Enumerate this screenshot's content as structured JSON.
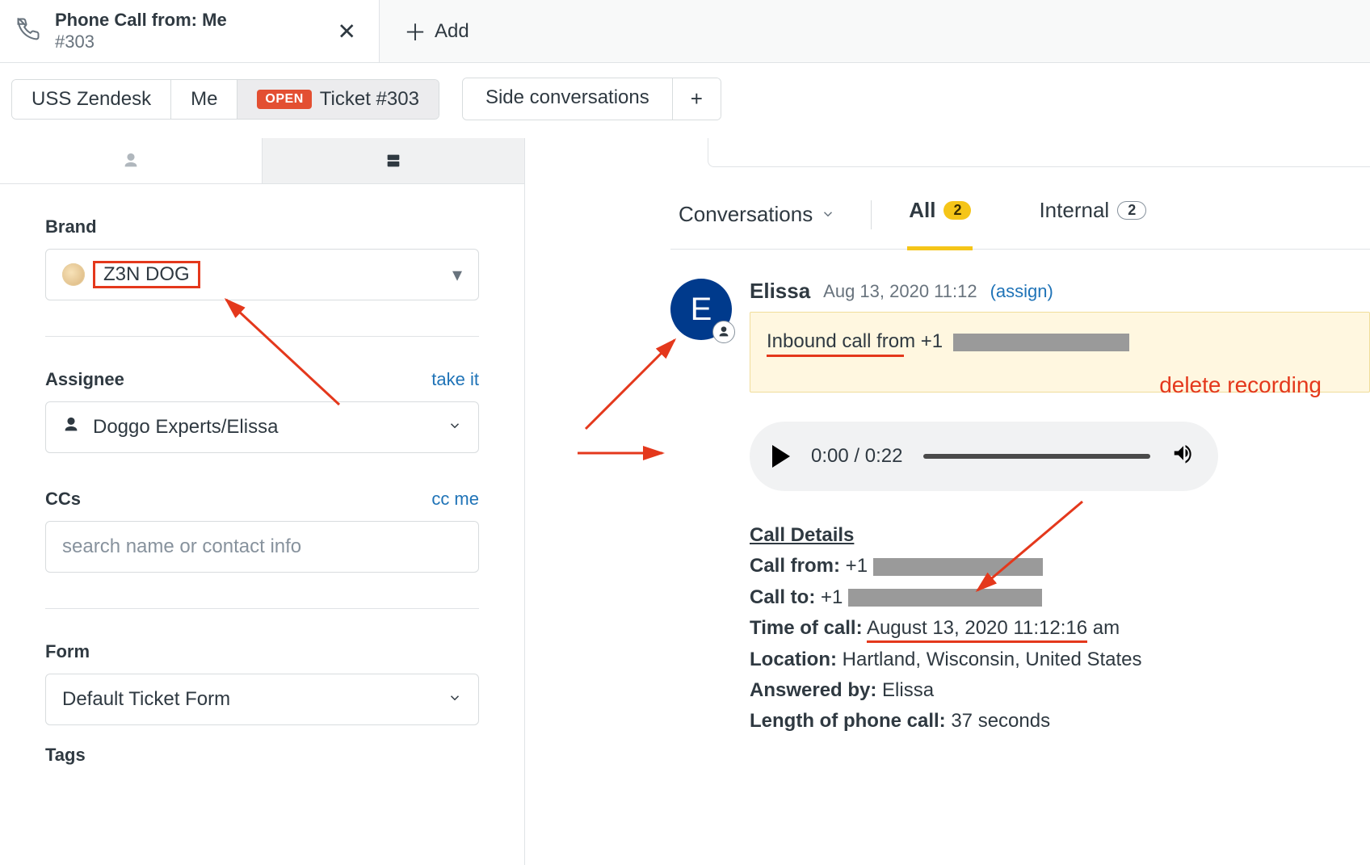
{
  "tab": {
    "title": "Phone Call from: Me",
    "sub": "#303",
    "add_label": "Add"
  },
  "breadcrumb": {
    "org": "USS Zendesk",
    "requester": "Me",
    "status": "OPEN",
    "ticket": "Ticket #303",
    "side_conversations": "Side conversations"
  },
  "side": {
    "brand": {
      "label": "Brand",
      "value": "Z3N DOG"
    },
    "assignee": {
      "label": "Assignee",
      "value": "Doggo Experts/Elissa",
      "take_it": "take it"
    },
    "ccs": {
      "label": "CCs",
      "cc_me": "cc me",
      "placeholder": "search name or contact info"
    },
    "form": {
      "label": "Form",
      "value": "Default Ticket Form"
    },
    "tags": {
      "label": "Tags"
    }
  },
  "filters": {
    "conversations": "Conversations",
    "all": "All",
    "all_count": "2",
    "internal": "Internal",
    "internal_count": "2"
  },
  "convo": {
    "initial": "E",
    "name": "Elissa",
    "date": "Aug 13, 2020 11:12",
    "assign": "(assign)",
    "note_lead": "Inbound call ",
    "note_tail": "from +1",
    "audio_time": "0:00 / 0:22",
    "delete": "delete recording"
  },
  "call": {
    "title": "Call Details",
    "from_label": "Call from:",
    "from_val_prefix": " +1 ",
    "to_label": "Call to:",
    "to_val_prefix": " +1 ",
    "time_label": "Time of call:",
    "time_val": "August 13, 2020 11:12:16",
    "time_suffix": " am",
    "loc_label": "Location:",
    "loc_val": " Hartland, Wisconsin, United States",
    "ans_label": "Answered by:",
    "ans_val": " Elissa",
    "len_label": "Length of phone call:",
    "len_val": " 37 seconds"
  }
}
